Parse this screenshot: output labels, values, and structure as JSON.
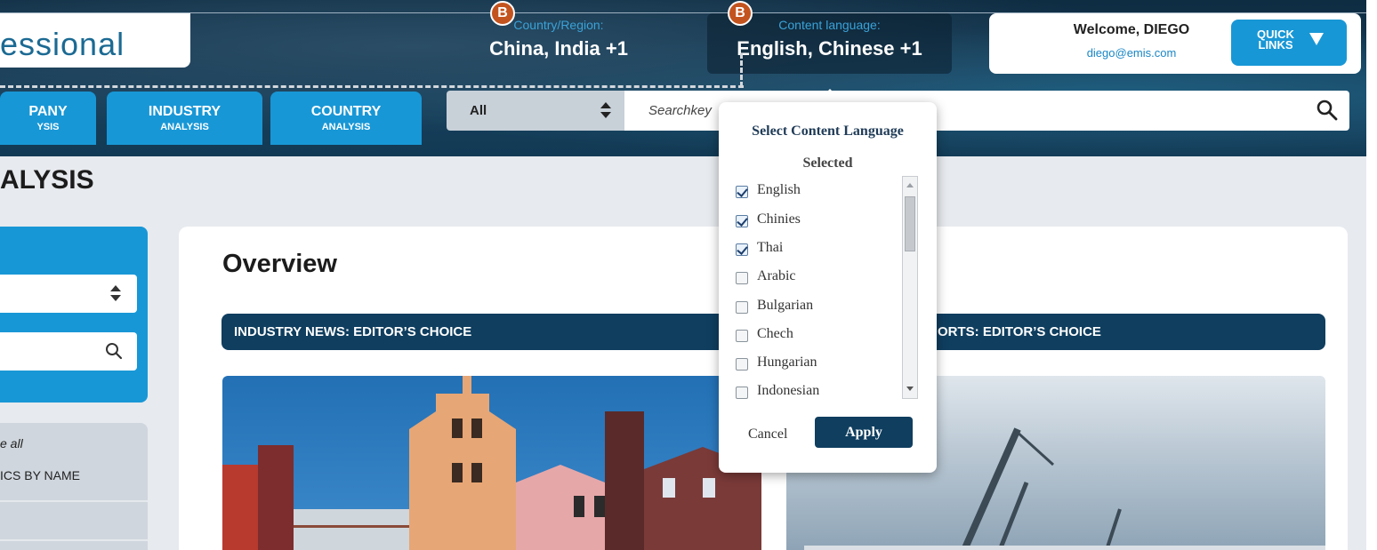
{
  "header": {
    "logo_text": "essional",
    "country": {
      "label": "Country/Region:",
      "value": "China, India +1",
      "badge": "B"
    },
    "content_language": {
      "label": "Content language:",
      "value": "English, Chinese +1",
      "badge": "B"
    },
    "welcome": {
      "name": "Welcome, DIEGO",
      "email": "diego@emis.com"
    },
    "quick_links": {
      "line1": "QUICK",
      "line2": "LINKS"
    }
  },
  "nav": {
    "tabs": [
      {
        "title": "PANY",
        "subtitle": "YSIS"
      },
      {
        "title": "INDUSTRY",
        "subtitle": "ANALYSIS"
      },
      {
        "title": "COUNTRY",
        "subtitle": "ANALYSIS"
      }
    ]
  },
  "search": {
    "scope": "All",
    "placeholder": "Searchkey"
  },
  "page": {
    "title": "ALYSIS",
    "sidebar": {
      "items": [
        {
          "label": "e all"
        },
        {
          "label": "ICS BY NAME"
        }
      ]
    },
    "overview": "Overview",
    "sections": [
      {
        "label": "INDUSTRY NEWS: EDITOR’S CHOICE"
      },
      {
        "label": "ORTS: EDITOR’S CHOICE"
      }
    ]
  },
  "language_popup": {
    "title": "Select Content Language",
    "subtitle": "Selected",
    "languages": [
      {
        "label": "English",
        "checked": true
      },
      {
        "label": "Chinies",
        "checked": true
      },
      {
        "label": "Thai",
        "checked": true
      },
      {
        "label": "Arabic",
        "checked": false
      },
      {
        "label": "Bulgarian",
        "checked": false
      },
      {
        "label": "Chech",
        "checked": false
      },
      {
        "label": "Hungarian",
        "checked": false
      },
      {
        "label": "Indonesian",
        "checked": false
      }
    ],
    "cancel_label": "Cancel",
    "apply_label": "Apply"
  },
  "colors": {
    "brand_blue": "#1897d6",
    "navy": "#0f3e5f",
    "badge_orange": "#c3541f"
  }
}
